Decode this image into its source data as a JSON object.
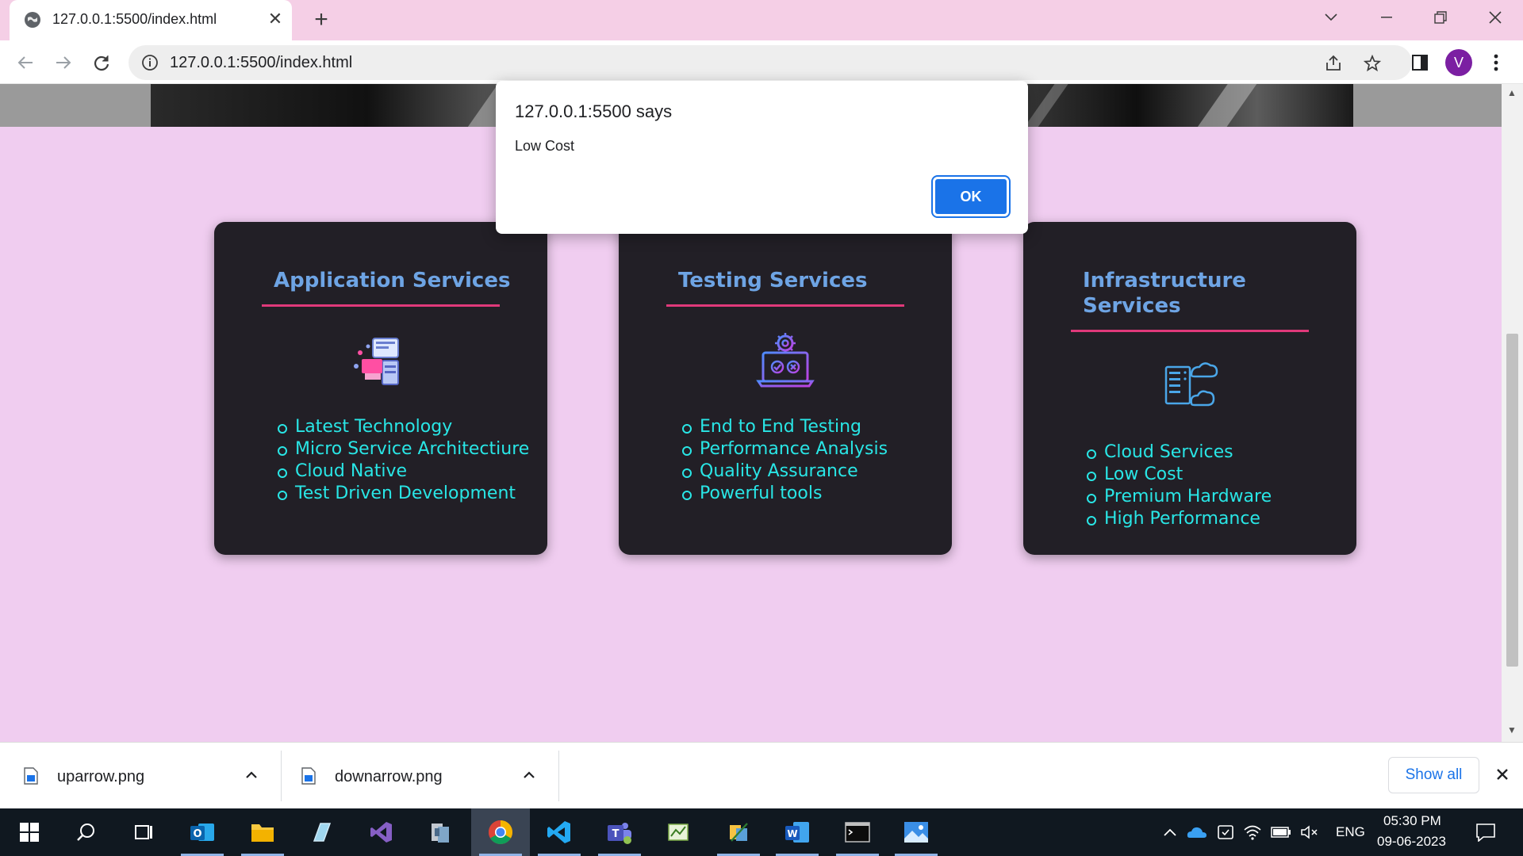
{
  "browser": {
    "tab_title": "127.0.0.1:5500/index.html",
    "tab_close_glyph": "✕",
    "new_tab_glyph": "+",
    "url": "127.0.0.1:5500/index.html",
    "profile_initial": "V"
  },
  "dialog": {
    "title": "127.0.0.1:5500 says",
    "message": "Low Cost",
    "ok_label": "OK"
  },
  "cards": [
    {
      "title": "Application Services",
      "icon": "developer-icon",
      "items": [
        "Latest Technology",
        "Micro Service Architectiure",
        "Cloud Native",
        "Test Driven Development"
      ]
    },
    {
      "title": "Testing Services",
      "icon": "laptop-gear-icon",
      "items": [
        "End to End Testing",
        "Performance Analysis",
        "Quality Assurance",
        "Powerful tools"
      ]
    },
    {
      "title": "Infrastructure Services",
      "icon": "server-cloud-icon",
      "items": [
        "Cloud Services",
        "Low Cost",
        "Premium Hardware",
        "High Performance"
      ]
    }
  ],
  "downloads": {
    "items": [
      {
        "name": "uparrow.png"
      },
      {
        "name": "downarrow.png"
      }
    ],
    "show_all_label": "Show all"
  },
  "taskbar": {
    "apps": [
      "start-icon",
      "search-icon",
      "task-view-icon",
      "outlook-icon",
      "file-explorer-icon",
      "notepad-icon",
      "visual-studio-icon",
      "archive-icon",
      "chrome-icon",
      "vscode-icon",
      "teams-icon",
      "spreadsheet-icon",
      "tool-icon",
      "word-icon",
      "terminal-icon",
      "photos-icon"
    ],
    "language": "ENG",
    "time": "05:30 PM",
    "date": "09-06-2023"
  },
  "colors": {
    "page_bg": "#f0cdf0",
    "card_bg": "#221f26",
    "card_title": "#6ea4e4",
    "card_rule": "#e0397a",
    "list_text": "#29e6e6",
    "dialog_button": "#1a73e8"
  }
}
